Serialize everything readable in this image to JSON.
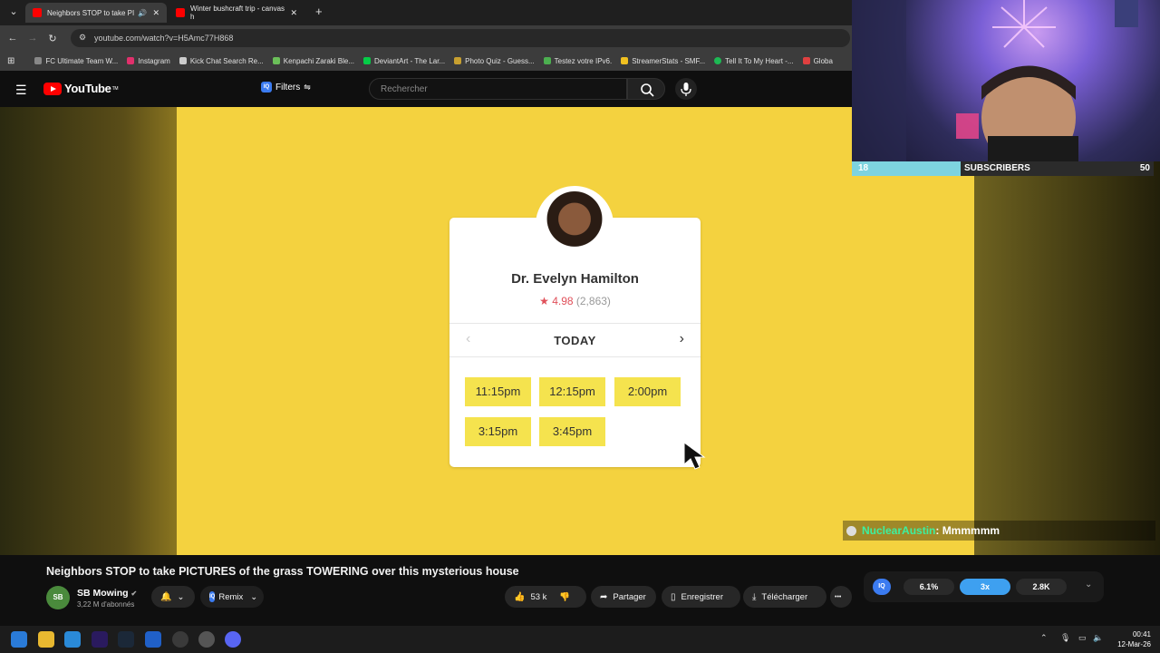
{
  "browser": {
    "tabs": [
      {
        "label": "Neighbors STOP to take PI",
        "active": true
      },
      {
        "label": "Winter bushcraft trip - canvas h",
        "active": false
      }
    ],
    "new_tab_label": "+",
    "url": "youtube.com/watch?v=H5Amc77H868",
    "bookmarks": [
      {
        "label": "FC Ultimate Team W...",
        "color": "#888888"
      },
      {
        "label": "Instagram",
        "color": "#e1306c"
      },
      {
        "label": "Kick Chat Search Re...",
        "color": "#cccccc"
      },
      {
        "label": "Kenpachi Zaraki Ble...",
        "color": "#6bbf59"
      },
      {
        "label": "DeviantArt - The Lar...",
        "color": "#05cc47"
      },
      {
        "label": "Photo Quiz - Guess...",
        "color": "#c8a030"
      },
      {
        "label": "Testez votre IPv6.",
        "color": "#4caf50"
      },
      {
        "label": "StreamerStats - SMF...",
        "color": "#f0c020"
      },
      {
        "label": "Tell It To My Heart -...",
        "color": "#1db954"
      },
      {
        "label": "Globa",
        "color": "#e04040"
      }
    ]
  },
  "youtube": {
    "logo_text": "YouTube",
    "logo_suffix": "TM",
    "filters_label": "Filters",
    "search_placeholder": "Rechercher"
  },
  "video_frame": {
    "doctor_name": "Dr. Evelyn Hamilton",
    "rating_star": "★",
    "rating_value": "4.98",
    "rating_count": "(2,863)",
    "day_label": "TODAY",
    "prev_arrow": "‹",
    "next_arrow": "›",
    "time_slots": [
      "11:15pm",
      "12:15pm",
      "2:00pm",
      "3:15pm",
      "3:45pm"
    ],
    "slot_color": "#f5e34e",
    "background_color": "#f4d23f"
  },
  "stream_overlay": {
    "sub_current": "18",
    "sub_label": "SUBSCRIBERS",
    "sub_goal": "50",
    "sub_progress": 0.36,
    "chat_user": "NuclearAustin",
    "chat_message": ": Mmmmmm"
  },
  "video_info": {
    "title": "Neighbors STOP to take PICTURES of the grass TOWERING over this mysterious house",
    "channel_avatar_text": "SB",
    "channel_name": "SB Mowing",
    "verified": "✔",
    "subscribers": "3,22 M d'abonnés",
    "remix_label": "Remix",
    "likes": "53 k",
    "share_label": "Partager",
    "save_label": "Enregistrer",
    "download_label": "Télécharger",
    "more_label": "•••"
  },
  "iq_panel": {
    "badge": "IQ",
    "stat1": "6.1%",
    "stat2": "3x",
    "stat3": "2.8K"
  },
  "taskbar": {
    "time": "00:41",
    "date": "12-Mar-26"
  }
}
